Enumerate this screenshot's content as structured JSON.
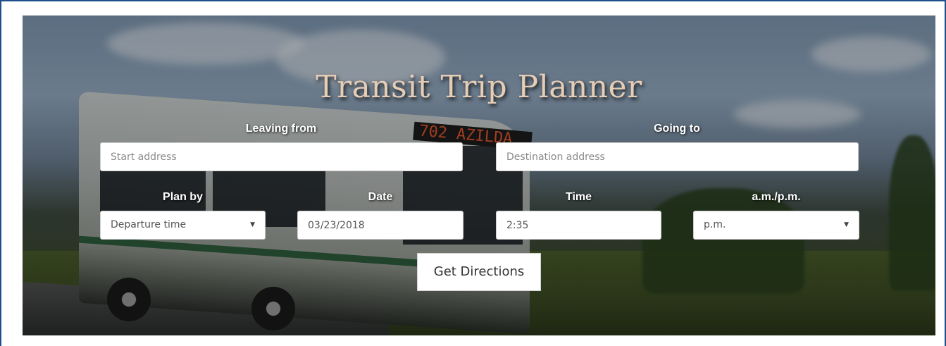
{
  "title": "Transit Trip Planner",
  "from": {
    "label": "Leaving from",
    "placeholder": "Start address"
  },
  "to": {
    "label": "Going to",
    "placeholder": "Destination address"
  },
  "plan_by": {
    "label": "Plan by",
    "value": "Departure time"
  },
  "date": {
    "label": "Date",
    "value": "03/23/2018"
  },
  "time": {
    "label": "Time",
    "value": "2:35"
  },
  "ampm": {
    "label": "a.m./p.m.",
    "value": "p.m."
  },
  "submit": {
    "label": "Get Directions"
  },
  "background": {
    "bus_sign": "702 AZILDA"
  },
  "colors": {
    "title": "#e6cdb6",
    "frame_border": "#1f4f8a"
  }
}
